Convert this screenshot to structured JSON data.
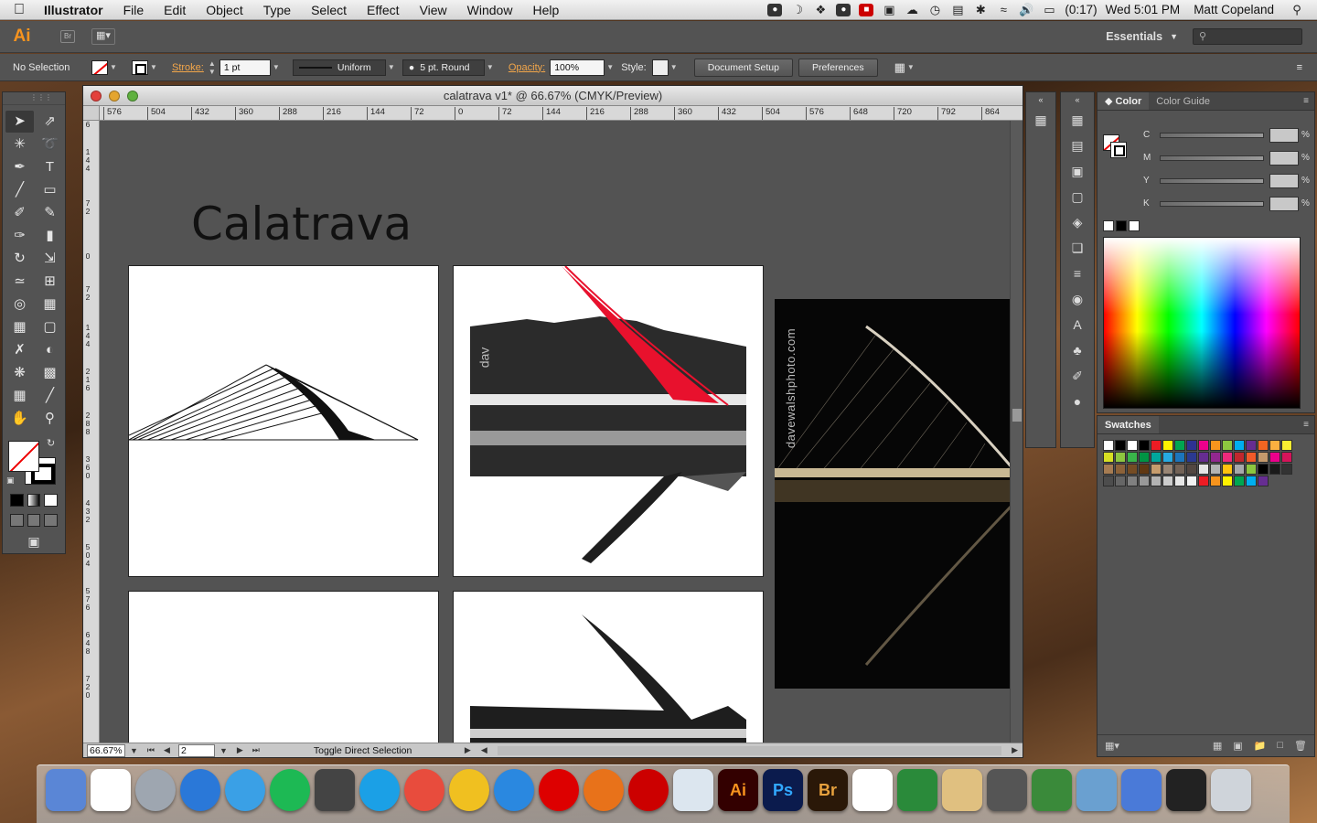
{
  "menubar": {
    "app": "Illustrator",
    "items": [
      "File",
      "Edit",
      "Object",
      "Type",
      "Select",
      "Effect",
      "View",
      "Window",
      "Help"
    ],
    "battery": "(0:17)",
    "clock": "Wed 5:01 PM",
    "user": "Matt Copeland"
  },
  "appbar": {
    "logo": "Ai",
    "bridge": "Br",
    "workspace": "Essentials"
  },
  "control": {
    "selection": "No Selection",
    "stroke_label": "Stroke:",
    "stroke_weight": "1 pt",
    "variable_width": "Uniform",
    "brush": "5 pt. Round",
    "opacity_label": "Opacity:",
    "opacity": "100%",
    "style_label": "Style:",
    "doc_setup": "Document Setup",
    "preferences": "Preferences"
  },
  "document": {
    "title": "calatrava v1* @ 66.67% (CMYK/Preview)",
    "heading": "Calatrava",
    "watermark": "davewalshphoto.com",
    "partial_text": "dav",
    "zoom": "66.67%",
    "page": "2",
    "status": "Toggle Direct Selection",
    "hruler": [
      "576",
      "504",
      "432",
      "360",
      "288",
      "216",
      "144",
      "72",
      "0",
      "72",
      "144",
      "216",
      "288",
      "360",
      "432",
      "504",
      "576",
      "648",
      "720",
      "792",
      "864"
    ],
    "vruler": [
      "6",
      "144",
      "72",
      "0",
      "72",
      "144",
      "216",
      "288",
      "360",
      "432",
      "504",
      "576",
      "648",
      "720"
    ]
  },
  "panels": {
    "color_tab": "Color",
    "color_guide_tab": "Color Guide",
    "swatches_tab": "Swatches",
    "cmyk_labels": [
      "C",
      "M",
      "Y",
      "K"
    ],
    "pct": "%"
  },
  "swatch_colors": [
    "#ffffff",
    "#000000",
    "#ffffff",
    "#000000",
    "#ed1c24",
    "#fff200",
    "#00a651",
    "#2e3192",
    "#ec008c",
    "#f7941d",
    "#8dc63f",
    "#00aeef",
    "#662d91",
    "#f26522",
    "#fbb040",
    "#f9ed32",
    "#d7df23",
    "#8dc63f",
    "#39b54a",
    "#009444",
    "#00a79d",
    "#27aae1",
    "#1c75bc",
    "#2b3990",
    "#662d91",
    "#92278f",
    "#ee2a7b",
    "#c1272d",
    "#f15a29",
    "#c49a6c",
    "#ec008c",
    "#d4145a",
    "#a67c52",
    "#8c6239",
    "#754c24",
    "#603813",
    "#c69c6d",
    "#998675",
    "#736357",
    "#534741",
    "#e6e6e6",
    "#b3b3b3",
    "#ffc20e",
    "#a7a9ac",
    "#8cc63f",
    "#000000",
    "#1a1a1a",
    "#333333",
    "#4d4d4d",
    "#666666",
    "#808080",
    "#999999",
    "#b3b3b3",
    "#cccccc",
    "#e6e6e6",
    "#f2f2f2",
    "#ed1c24",
    "#f7941d",
    "#fff200",
    "#00a651",
    "#00aeef",
    "#662d91"
  ],
  "dock": [
    "Finder",
    "Calendar",
    "Launchpad",
    "App Store",
    "iTunes",
    "Spotify",
    "Steam",
    "Skype",
    "Chrome",
    "Canary",
    "Safari",
    "Opera",
    "Firefox",
    "RSA",
    "Preview",
    "Ai",
    "Ps",
    "Br",
    "Acrobat",
    "Mind",
    "Cocoa",
    "S",
    "Coda",
    "Chrome2",
    "Xcode",
    "Terminal",
    "Trash"
  ]
}
